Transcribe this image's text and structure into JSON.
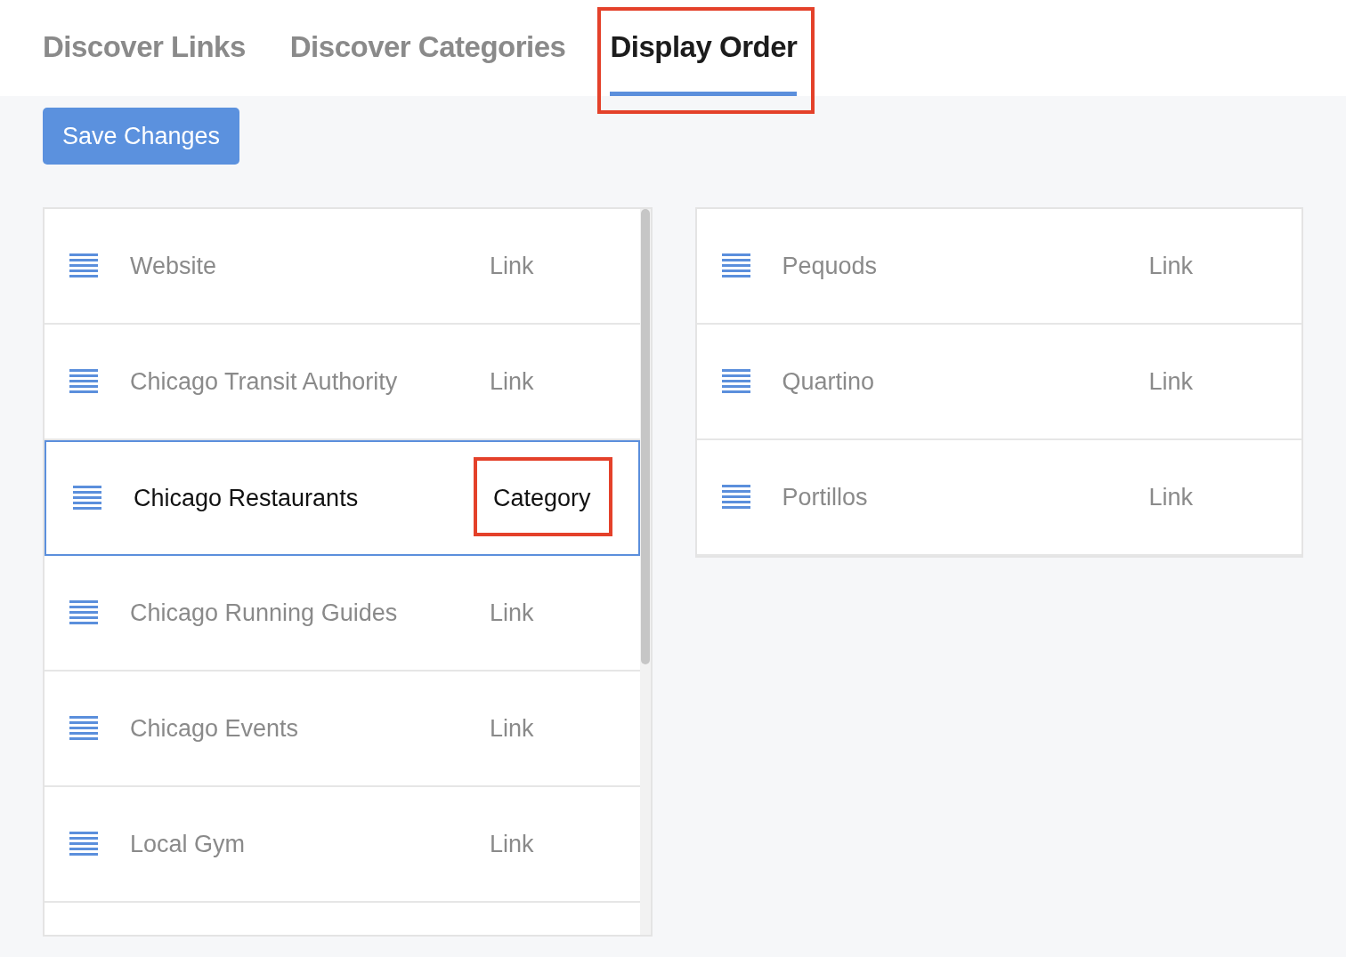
{
  "tabs": [
    {
      "label": "Discover Links",
      "selected": false,
      "highlighted": false
    },
    {
      "label": "Discover Categories",
      "selected": false,
      "highlighted": false
    },
    {
      "label": "Display Order",
      "selected": true,
      "highlighted": true
    }
  ],
  "save_button": {
    "label": "Save Changes"
  },
  "left_list": {
    "items": [
      {
        "name": "Website",
        "type": "Link",
        "selected": false,
        "highlighted": false
      },
      {
        "name": "Chicago Transit Authority",
        "type": "Link",
        "selected": false,
        "highlighted": false
      },
      {
        "name": "Chicago Restaurants",
        "type": "Category",
        "selected": true,
        "highlighted": true
      },
      {
        "name": "Chicago Running Guides",
        "type": "Link",
        "selected": false,
        "highlighted": false
      },
      {
        "name": "Chicago Events",
        "type": "Link",
        "selected": false,
        "highlighted": false
      },
      {
        "name": "Local Gym",
        "type": "Link",
        "selected": false,
        "highlighted": false
      }
    ]
  },
  "right_list": {
    "items": [
      {
        "name": "Pequods",
        "type": "Link",
        "selected": false,
        "highlighted": false
      },
      {
        "name": "Quartino",
        "type": "Link",
        "selected": false,
        "highlighted": false
      },
      {
        "name": "Portillos",
        "type": "Link",
        "selected": false,
        "highlighted": false
      }
    ]
  }
}
